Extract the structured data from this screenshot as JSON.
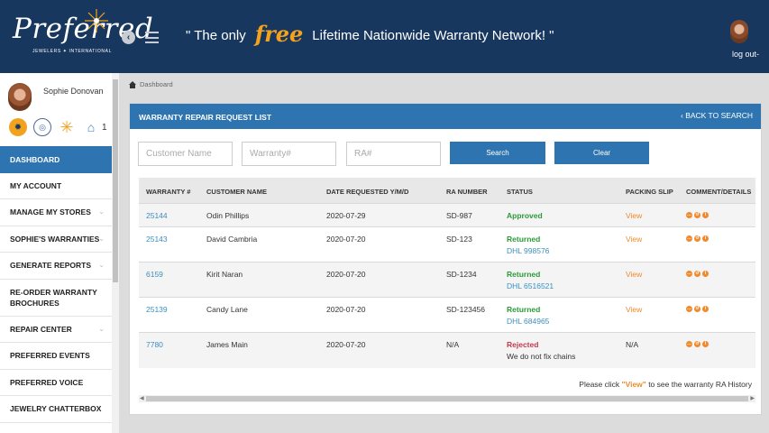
{
  "header": {
    "logo_script": "Preferred",
    "logo_sub": "JEWELERS ✦ INTERNATIONAL",
    "slogan_pre": "\" The only",
    "slogan_free": "free",
    "slogan_post": "Lifetime Nationwide Warranty Network! \"",
    "logout": "log out-"
  },
  "sidebar": {
    "profile_name": "Sophie Donovan",
    "home_count": "1",
    "items": [
      {
        "label": "DASHBOARD"
      },
      {
        "label": "MY ACCOUNT"
      },
      {
        "label": "MANAGE MY STORES"
      },
      {
        "label": "SOPHIE'S WARRANTIES"
      },
      {
        "label": "GENERATE REPORTS"
      },
      {
        "label": "RE-ORDER WARRANTY BROCHURES"
      },
      {
        "label": "REPAIR CENTER"
      },
      {
        "label": "PREFERRED EVENTS"
      },
      {
        "label": "PREFERRED VOICE"
      },
      {
        "label": "JEWELRY CHATTERBOX"
      }
    ]
  },
  "breadcrumb": "Dashboard",
  "panel": {
    "title": "WARRANTY REPAIR REQUEST LIST",
    "back_label": "BACK TO SEARCH",
    "customer_placeholder": "Customer Name",
    "warranty_placeholder": "Warranty#",
    "ra_placeholder": "RA#",
    "search_label": "Search",
    "clear_label": "Clear"
  },
  "table": {
    "headers": {
      "warranty": "WARRANTY #",
      "customer": "CUSTOMER NAME",
      "date": "DATE REQUESTED Y/M/D",
      "ra": "RA NUMBER",
      "status": "STATUS",
      "slip": "PACKING SLIP",
      "comment": "COMMENT/DETAILS"
    },
    "rows": [
      {
        "warranty": "25144",
        "customer": "Odin Phillips",
        "date": "2020-07-29",
        "ra": "SD-987",
        "status": "Approved",
        "detail": "",
        "slip": "View"
      },
      {
        "warranty": "25143",
        "customer": "David Cambria",
        "date": "2020-07-20",
        "ra": "SD-123",
        "status": "Returned",
        "detail": "DHL 998576",
        "slip": "View"
      },
      {
        "warranty": "6159",
        "customer": "Kirit Naran",
        "date": "2020-07-20",
        "ra": "SD-1234",
        "status": "Returned",
        "detail": "DHL 6516521",
        "slip": "View"
      },
      {
        "warranty": "25139",
        "customer": "Candy Lane",
        "date": "2020-07-20",
        "ra": "SD-123456",
        "status": "Returned",
        "detail": "DHL 684965",
        "slip": "View"
      },
      {
        "warranty": "7780",
        "customer": "James Main",
        "date": "2020-07-20",
        "ra": "N/A",
        "status": "Rejected",
        "detail": "We do not fix chains",
        "slip": "N/A"
      }
    ]
  },
  "note": {
    "pre": "Please click ",
    "view": "\"View\"",
    "post": " to see the warranty RA History"
  },
  "colors": {
    "header_bg": "#17375f",
    "accent": "#2e74b0",
    "orange": "#f08a2c",
    "approved": "#2b9a38",
    "rejected": "#c4384d"
  }
}
